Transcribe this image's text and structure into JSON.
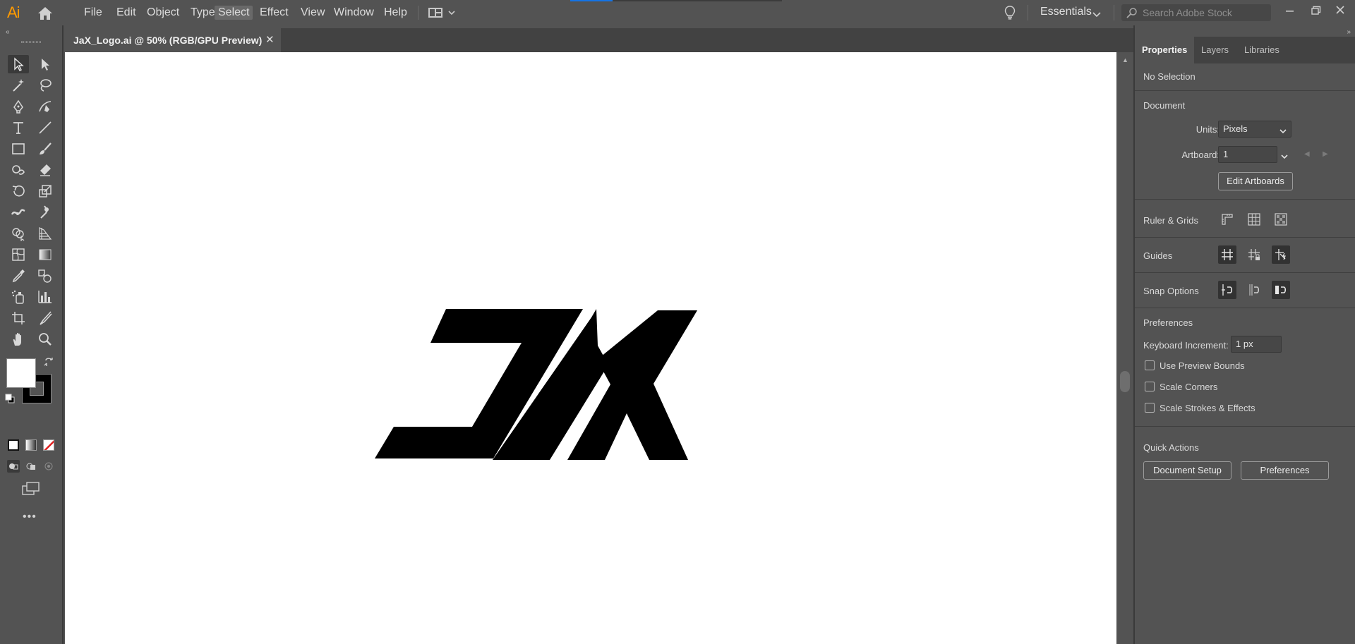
{
  "app": {
    "logo": "Ai",
    "brand_color": "#ff9a00",
    "accent_color": "#1473e6"
  },
  "menu": [
    "File",
    "Edit",
    "Object",
    "Type",
    "Select",
    "Effect",
    "View",
    "Window",
    "Help"
  ],
  "menu_active": "Select",
  "workspace": {
    "label": "Essentials"
  },
  "search": {
    "placeholder": "Search Adobe Stock"
  },
  "document": {
    "tab_title": "JaX_Logo.ai @ 50% (RGB/GPU Preview)",
    "close_glyph": "✕"
  },
  "artwork": {
    "logo_text": "JAX",
    "fill": "#000000"
  },
  "panel": {
    "tabs": [
      "Properties",
      "Layers",
      "Libraries"
    ],
    "active_tab": "Properties",
    "selection_status": "No Selection",
    "document_header": "Document",
    "units_label": "Units:",
    "units_value": "Pixels",
    "artboard_label": "Artboard:",
    "artboard_value": "1",
    "edit_artboards": "Edit Artboards",
    "ruler_grids": "Ruler & Grids",
    "guides": "Guides",
    "snap_options": "Snap Options",
    "preferences_header": "Preferences",
    "keyboard_increment_label": "Keyboard Increment:",
    "keyboard_increment_value": "1 px",
    "checkboxes": [
      {
        "label": "Use Preview Bounds",
        "checked": false
      },
      {
        "label": "Scale Corners",
        "checked": false
      },
      {
        "label": "Scale Strokes & Effects",
        "checked": false
      }
    ],
    "quick_actions_header": "Quick Actions",
    "document_setup": "Document Setup",
    "preferences_button": "Preferences"
  },
  "tools": [
    "selection-tool",
    "direct-selection-tool",
    "magic-wand-tool",
    "lasso-tool",
    "pen-tool",
    "curvature-tool",
    "type-tool",
    "line-segment-tool",
    "rectangle-tool",
    "paintbrush-tool",
    "shaper-tool",
    "eraser-tool",
    "rotate-tool",
    "scale-tool",
    "width-tool",
    "puppet-warp-tool",
    "shape-builder-tool",
    "perspective-grid-tool",
    "mesh-tool",
    "gradient-tool",
    "eyedropper-tool",
    "blend-tool",
    "symbol-sprayer-tool",
    "column-graph-tool",
    "artboard-tool",
    "slice-tool",
    "hand-tool",
    "zoom-tool"
  ],
  "colors": {
    "fill": "#ffffff",
    "stroke": "#000000"
  }
}
